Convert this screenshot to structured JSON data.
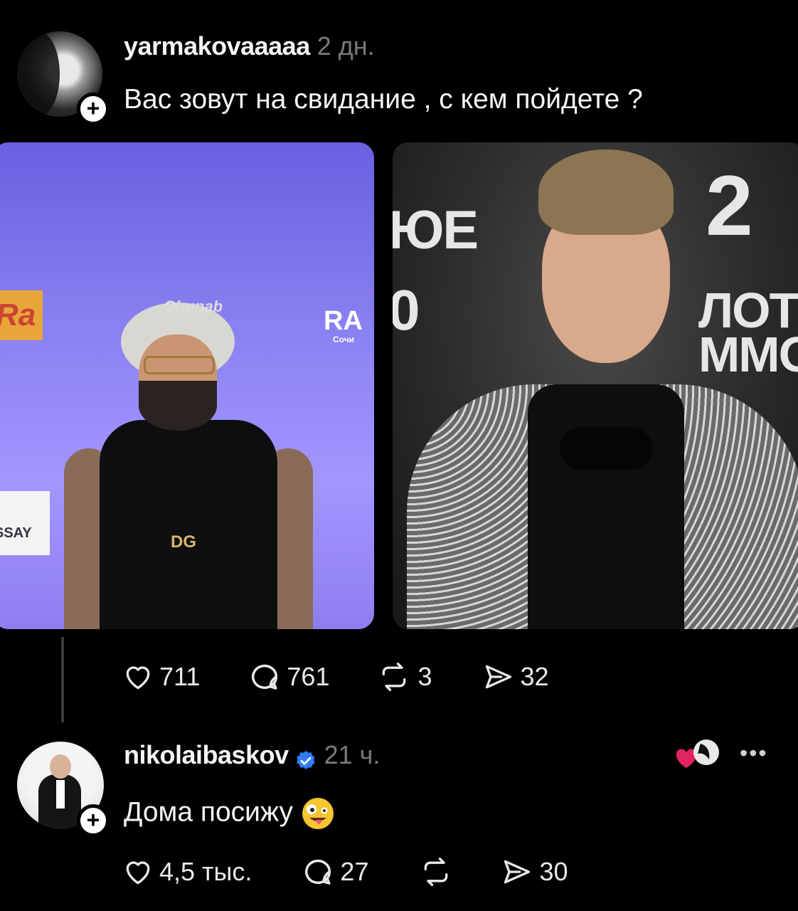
{
  "post": {
    "username": "yarmakovaaaaa",
    "time": "2 дн.",
    "text": "Вас зовут на свидание , с кем пойдете ?",
    "images": [
      {
        "texts": [
          "Ra",
          "RA",
          "Сочи",
          "SSAY",
          "DG",
          "Ohupab"
        ]
      },
      {
        "texts": [
          "ЮЕ",
          "0",
          "2",
          "ЛОТ",
          "ММО"
        ]
      }
    ],
    "actions": {
      "likes": "711",
      "comments": "761",
      "reposts": "3",
      "shares": "32"
    }
  },
  "reply": {
    "username": "nikolaibaskov",
    "time": "21 ч.",
    "text": "Дома посижу",
    "more": "•••",
    "actions": {
      "likes": "4,5 тыс.",
      "comments": "27",
      "shares": "30"
    }
  },
  "icons": [
    "heart-icon",
    "comment-icon",
    "repost-icon",
    "share-icon",
    "verified-icon",
    "plus-icon",
    "more-icon",
    "zany-face-emoji"
  ],
  "colors": {
    "background": "#000000",
    "text": "#f5f5f5",
    "muted": "#7a7a7a",
    "verified": "#2f7cf6",
    "like": "#e0245e"
  }
}
